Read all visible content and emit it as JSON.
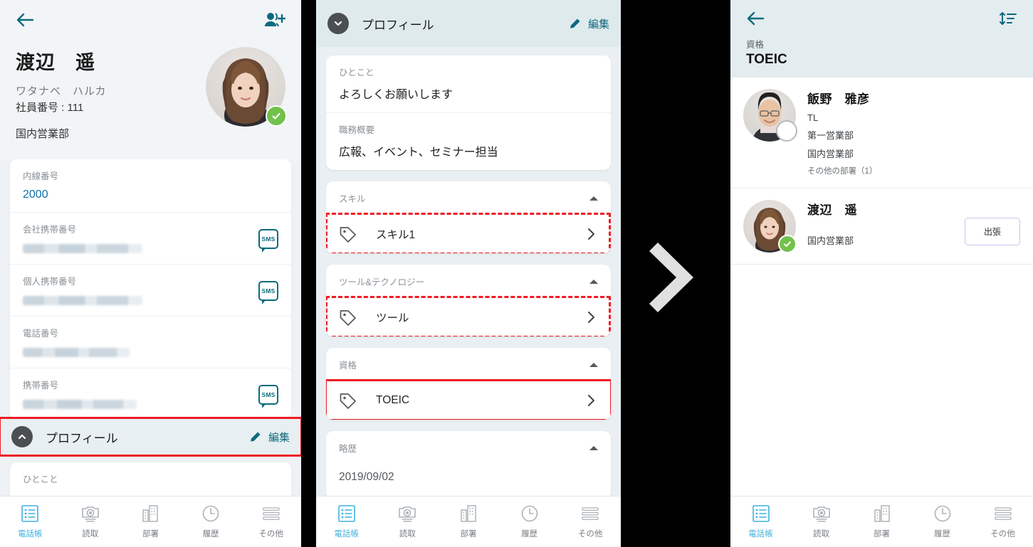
{
  "panel1": {
    "back_icon": "arrow-left-icon",
    "add_person_icon": "add-person-icon",
    "person": {
      "name": "渡辺　遥",
      "kana": "ワタナベ　ハルカ",
      "employee_no": "社員番号 : 111",
      "department": "国内営業部",
      "status": "available"
    },
    "fields": [
      {
        "label": "内線番号",
        "value": "2000",
        "masked": false,
        "link": true,
        "sms": false
      },
      {
        "label": "会社携帯番号",
        "value": "",
        "masked": true,
        "link": false,
        "sms": true
      },
      {
        "label": "個人携帯番号",
        "value": "",
        "masked": true,
        "link": false,
        "sms": true
      },
      {
        "label": "電話番号",
        "value": "",
        "masked": true,
        "link": false,
        "sms": false
      },
      {
        "label": "携帯番号",
        "value": "",
        "masked": true,
        "link": false,
        "sms": true
      }
    ],
    "profile_header": {
      "title": "プロフィール",
      "edit_label": "編集",
      "collapsed": false
    },
    "profile_first_label": "ひとこと"
  },
  "panel2": {
    "header": {
      "title": "プロフィール",
      "edit_label": "編集"
    },
    "text_fields": [
      {
        "label": "ひとこと",
        "value": "よろしくお願いします"
      },
      {
        "label": "職務概要",
        "value": "広報、イベント、セミナー担当"
      }
    ],
    "sections": [
      {
        "title": "スキル",
        "items": [
          "スキル1"
        ],
        "highlight": "dashed"
      },
      {
        "title": "ツール&テクノロジー",
        "items": [
          "ツール"
        ],
        "highlight": "dashed"
      },
      {
        "title": "資格",
        "items": [
          "TOEIC"
        ],
        "highlight": "solid"
      },
      {
        "title": "略歴",
        "items": [
          "2019/09/02"
        ],
        "highlight": "none"
      }
    ]
  },
  "panel3": {
    "back_icon": "arrow-left-icon",
    "sort_icon": "sort-icon",
    "kind_label": "資格",
    "kind_value": "TOEIC",
    "results": [
      {
        "name": "飯野　雅彦",
        "title": "TL",
        "dept1": "第一営業部",
        "dept2": "国内営業部",
        "other": "その他の部署（1）",
        "status": "offline",
        "badge": ""
      },
      {
        "name": "渡辺　遥",
        "title": "",
        "dept1": "国内営業部",
        "dept2": "",
        "other": "",
        "status": "available",
        "badge": "出張"
      }
    ]
  },
  "bottom_nav": {
    "items": [
      {
        "label": "電話帳",
        "icon": "contact-list-icon",
        "active": true
      },
      {
        "label": "読取",
        "icon": "camera-icon",
        "active": false
      },
      {
        "label": "部署",
        "icon": "building-icon",
        "active": false
      },
      {
        "label": "履歴",
        "icon": "clock-icon",
        "active": false
      },
      {
        "label": "その他",
        "icon": "menu-icon",
        "active": false
      }
    ]
  },
  "colors": {
    "accent_teal": "#0c6a7d",
    "highlight_red": "#ee1b24",
    "nav_active": "#3fb3df",
    "status_green": "#72c14b",
    "header_bg": "#dfeaed"
  },
  "separator_icon": "chevron-right-icon"
}
